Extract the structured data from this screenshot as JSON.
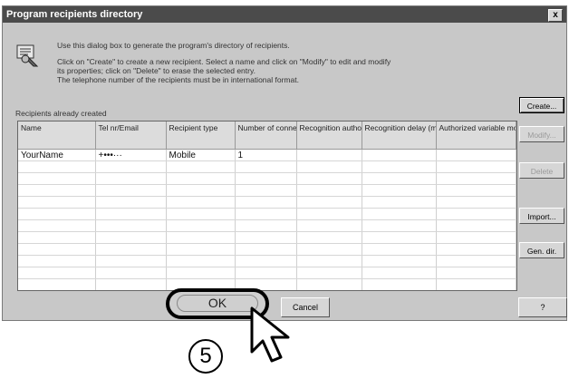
{
  "window": {
    "title": "Program recipients directory",
    "close_glyph": "x"
  },
  "intro": {
    "line1": "Use this dialog box to generate the program's directory of recipients.",
    "line2": "Click on  \"Create\" to create a new recipient. Select a name and click on  \"Modify\" to edit and modify",
    "line3": "its properties; click on  \"Delete\" to erase the selected entry.",
    "line4": "The telephone number of the recipients must be in international format."
  },
  "table": {
    "caption": "Recipients already created",
    "headers": [
      "Name",
      "Tel nr/Email",
      "Recipient type",
      "Number of connection attempts",
      "Recognition authorized",
      "Recognition delay (minutes)",
      "Authorized variable modification"
    ],
    "rows": [
      [
        "YourName",
        "+•••···",
        "Mobile",
        "1",
        "",
        "",
        ""
      ]
    ]
  },
  "buttons": {
    "create": "Create...",
    "modify": "Modify...",
    "delete": "Delete",
    "import": "Import...",
    "gen_dir": "Gen. dir.",
    "ok": "OK",
    "cancel": "Cancel",
    "help": "?"
  },
  "annotation": {
    "step": "5"
  }
}
